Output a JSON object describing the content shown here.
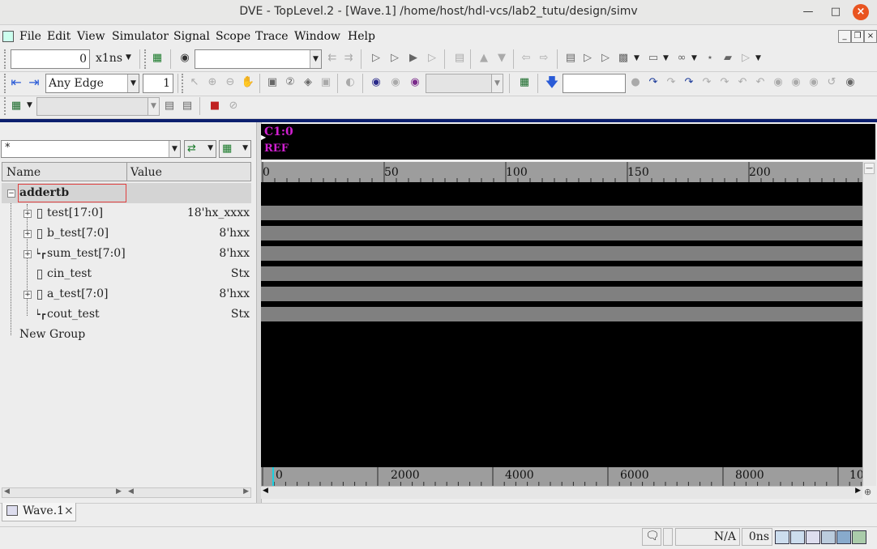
{
  "window": {
    "title": "DVE - TopLevel.2 - [Wave.1]  /home/host/hdl-vcs/lab2_tutu/design/simv"
  },
  "menu": [
    "File",
    "Edit",
    "View",
    "Simulator",
    "Signal",
    "Scope",
    "Trace",
    "Window",
    "Help"
  ],
  "toolbar1": {
    "time_value": "0",
    "time_unit": "x1ns",
    "search_value": ""
  },
  "toolbar2": {
    "edge_select": "Any Edge",
    "edge_count": "1",
    "zoom_select": "",
    "step_value": ""
  },
  "toolbar3": {
    "scope_select": ""
  },
  "signal_panel": {
    "filter_value": "*",
    "columns": {
      "name": "Name",
      "value": "Value"
    },
    "scope": "addertb",
    "signals": [
      {
        "name": "test[17:0]",
        "value": "18'hx_xxxx",
        "kind": "bus",
        "expandable": true
      },
      {
        "name": "b_test[7:0]",
        "value": "8'hxx",
        "kind": "bus",
        "expandable": true
      },
      {
        "name": "sum_test[7:0]",
        "value": "8'hxx",
        "kind": "wire",
        "expandable": true
      },
      {
        "name": "cin_test",
        "value": "Stx",
        "kind": "bus",
        "expandable": false
      },
      {
        "name": "a_test[7:0]",
        "value": "8'hxx",
        "kind": "bus",
        "expandable": true
      },
      {
        "name": "cout_test",
        "value": "Stx",
        "kind": "wire",
        "expandable": false
      }
    ],
    "group": "New Group"
  },
  "wave_panel": {
    "cursor_label": "C1:0",
    "ref_label": "REF",
    "cursor_color": "#d020d0",
    "top_ruler": [
      "0",
      "50",
      "100",
      "150",
      "200"
    ],
    "bottom_ruler": [
      "0",
      "2000",
      "4000",
      "6000",
      "8000",
      "10"
    ]
  },
  "tabs": [
    {
      "label": "Wave.1",
      "close": "×"
    }
  ],
  "status": {
    "na": "N/A",
    "time": "0ns"
  },
  "colors": {
    "wave_bg": "#000000",
    "wave_signal": "#808080",
    "scope_highlight": "#e04040"
  }
}
